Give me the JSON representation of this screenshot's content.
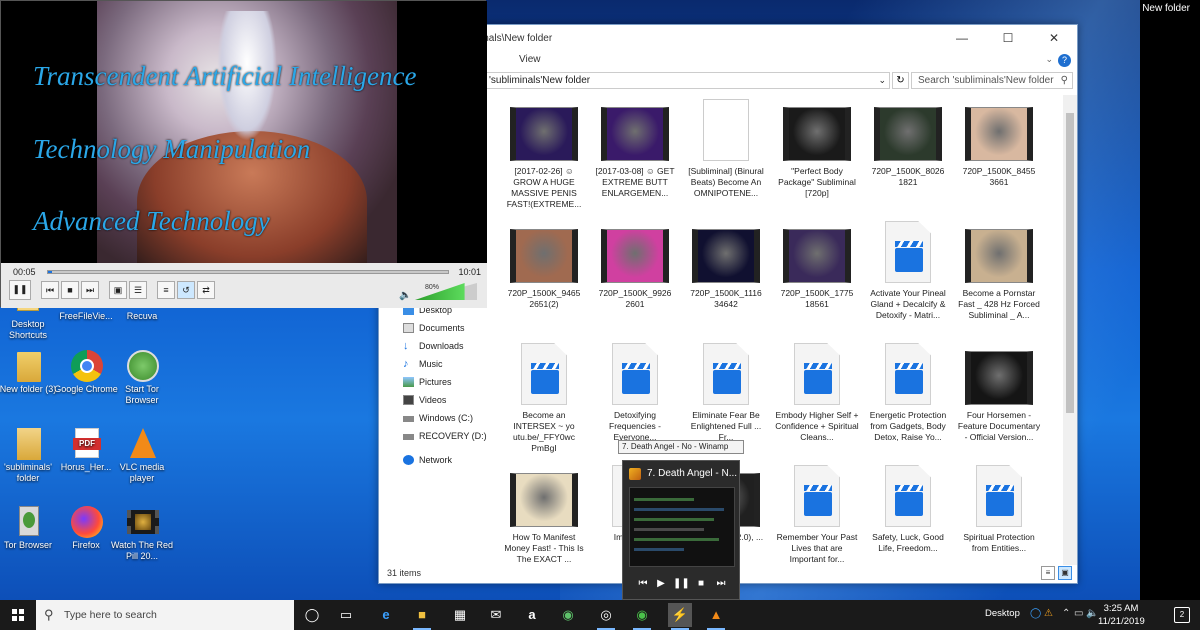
{
  "desktop": {
    "corner_label": "New folder",
    "icons": [
      {
        "label": "Desktop Shortcuts",
        "icon": "shortcut-icon"
      },
      {
        "label": "FreeFileVie...",
        "icon": "app-icon"
      },
      {
        "label": "Recuva",
        "icon": "recuva-icon"
      },
      {
        "label": "New folder (3)",
        "icon": "folder-icon"
      },
      {
        "label": "Google Chrome",
        "icon": "chrome-icon"
      },
      {
        "label": "Start Tor Browser",
        "icon": "tor-icon"
      },
      {
        "label": "'subliminals' folder",
        "icon": "folder-icon"
      },
      {
        "label": "Horus_Her...",
        "icon": "pdf-icon"
      },
      {
        "label": "VLC media player",
        "icon": "vlc-icon"
      },
      {
        "label": "Tor Browser",
        "icon": "tor-icon"
      },
      {
        "label": "Firefox",
        "icon": "firefox-icon"
      },
      {
        "label": "Watch The Red Pill 20...",
        "icon": "video-icon"
      }
    ]
  },
  "vlc": {
    "lines": [
      "Transcendent Artificial Intelligence",
      "Technology Manipulation",
      "Advanced Technology"
    ],
    "time_current": "00:05",
    "time_total": "10:01",
    "progress": 0.01,
    "volume_label": "80%",
    "volume": 0.8
  },
  "explorer": {
    "title": "inals\\New folder",
    "ribbon_view": "View",
    "address": "'subliminals'New folder",
    "search_placeholder": "Search 'subliminals'New folder",
    "status": "31 items",
    "nav": [
      {
        "label": "Desktop",
        "icon": "desktop-icon"
      },
      {
        "label": "Documents",
        "icon": "documents-icon"
      },
      {
        "label": "Downloads",
        "icon": "downloads-icon"
      },
      {
        "label": "Music",
        "icon": "music-icon"
      },
      {
        "label": "Pictures",
        "icon": "pictures-icon"
      },
      {
        "label": "Videos",
        "icon": "videos-icon"
      },
      {
        "label": "Windows (C:)",
        "icon": "drive-icon"
      },
      {
        "label": "RECOVERY (D:)",
        "icon": "drive-icon"
      },
      {
        "label": "Network",
        "icon": "network-icon"
      }
    ],
    "files": [
      {
        "name": "[2017-02-26] ☺ GROW A HUGE MASSIVE PENIS FAST!(EXTREME...",
        "kind": "film",
        "color": "#2a1a5a"
      },
      {
        "name": "[2017-03-08] ☺ GET EXTREME BUTT ENLARGEMEN...",
        "kind": "film",
        "color": "#3a1a6a"
      },
      {
        "name": "[Subliminal] (Binural Beats) Become An OMNIPOTENE...",
        "kind": "image",
        "color": "#f2e6c8"
      },
      {
        "name": "\"Perfect Body Package\" Subliminal [720p]",
        "kind": "film",
        "color": "#1a1a1a"
      },
      {
        "name": "720P_1500K_8026 1821",
        "kind": "film",
        "color": "#2c3a2c"
      },
      {
        "name": "720P_1500K_8455 3661",
        "kind": "film",
        "color": "#d8b8a0"
      },
      {
        "name": "720P_1500K_9465 2651(2)",
        "kind": "film",
        "color": "#a06a50"
      },
      {
        "name": "720P_1500K_9926 2601",
        "kind": "film",
        "color": "#d040a0"
      },
      {
        "name": "720P_1500K_1116 34642",
        "kind": "film",
        "color": "#101030"
      },
      {
        "name": "720P_1500K_1775 18561",
        "kind": "film",
        "color": "#3a2a5a"
      },
      {
        "name": "Activate Your Pineal Gland + Decalcify & Detoxify - Matri...",
        "kind": "doc",
        "color": ""
      },
      {
        "name": "Become a Pornstar Fast _ 428 Hz Forced Subliminal _ A...",
        "kind": "film",
        "color": "#c8b090"
      },
      {
        "name": "Become an INTERSEX ~ yo utu.be/_FFY0wc PmBgI",
        "kind": "doc",
        "color": ""
      },
      {
        "name": "Detoxifying Frequencies - Everyone...",
        "kind": "doc",
        "color": ""
      },
      {
        "name": "Eliminate Fear Be Enlightened Full ... Fr...",
        "kind": "doc",
        "color": ""
      },
      {
        "name": "Embody Higher Self + Confidence + Spiritual Cleans...",
        "kind": "doc",
        "color": ""
      },
      {
        "name": "Energetic Protection from Gadgets, Body Detox, Raise Yo...",
        "kind": "doc",
        "color": ""
      },
      {
        "name": "Four Horsemen - Feature Documentary - Official Version...",
        "kind": "film",
        "color": "#151515"
      },
      {
        "name": "How To Manifest Money Fast! - This Is The EXACT ...",
        "kind": "film",
        "color": "#e8dcc0"
      },
      {
        "name": "Imp... Me...",
        "kind": "doc",
        "color": ""
      },
      {
        "name": "...ing DJ ...e 2.0), ...",
        "kind": "film",
        "color": "#202020"
      },
      {
        "name": "Remember Your Past Lives that are Important for...",
        "kind": "doc",
        "color": ""
      },
      {
        "name": "Safety, Luck, Good Life, Freedom...",
        "kind": "doc",
        "color": ""
      },
      {
        "name": "Spiritual Protection from Entities...",
        "kind": "doc",
        "color": ""
      }
    ]
  },
  "winamp": {
    "tooltip": "7. Death Angel - No - Winamp",
    "title": "7. Death Angel - N..."
  },
  "taskbar": {
    "search_placeholder": "Type here to search",
    "desktop_label": "Desktop",
    "time": "3:25 AM",
    "date": "11/21/2019",
    "notification_count": "2"
  }
}
